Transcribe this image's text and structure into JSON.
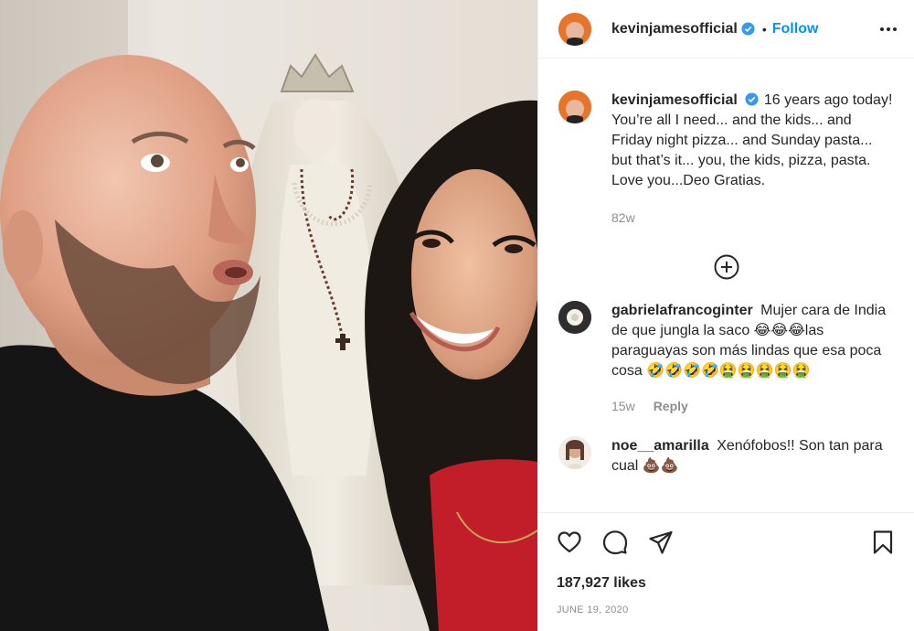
{
  "post": {
    "author": "kevinjamesofficial",
    "follow_label": "Follow",
    "separator": "•",
    "caption": "16 years ago today! You’re all I need... and the kids... and Friday night pizza... and Sunday pasta... but that’s it... you, the kids, pizza, pasta. Love you...Deo Gratias.",
    "caption_age": "82w",
    "likes": "187,927 likes",
    "date": "JUNE 19, 2020"
  },
  "comments": [
    {
      "username": "gabrielafrancoginter",
      "text": "Mujer cara de India de que jungla la saco 😂😂😂las paraguayas son más lindas que esa poca cosa 🤣🤣🤣🤣🤮🤮🤮🤮🤮",
      "age": "15w",
      "reply_label": "Reply"
    },
    {
      "username": "noe__amarilla",
      "text": "Xenófobos!! Son tan para cual 💩💩"
    }
  ],
  "icons": {
    "verified": "verified-badge-icon",
    "more": "more-options-icon",
    "load_more": "plus-circle-icon",
    "like": "heart-icon",
    "comment": "comment-bubble-icon",
    "share": "paper-plane-icon",
    "save": "bookmark-icon"
  },
  "colors": {
    "follow_blue": "#0095f6",
    "verified_blue": "#3897f0",
    "secondary_text": "#8e8e8e",
    "border": "#efefef"
  }
}
